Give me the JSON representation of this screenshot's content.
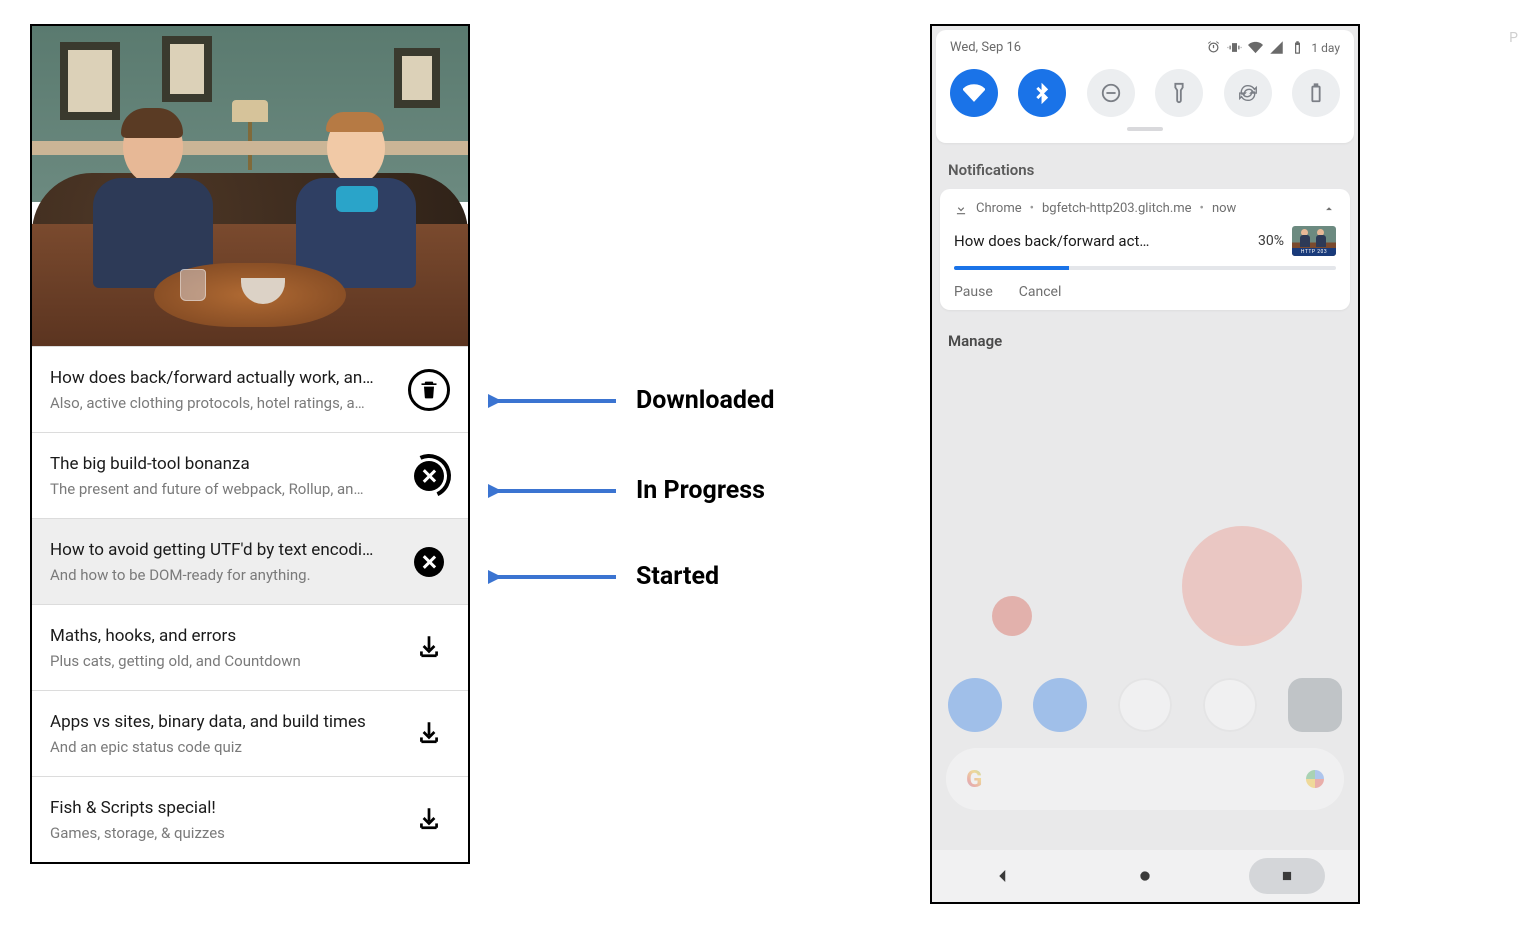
{
  "left": {
    "episodes": [
      {
        "title": "How does back/forward actually work, an…",
        "subtitle": "Also, active clothing protocols, hotel ratings, a…",
        "state": "downloaded",
        "selected": false
      },
      {
        "title": "The big build-tool bonanza",
        "subtitle": "The present and future of webpack, Rollup, an…",
        "state": "in_progress",
        "selected": false
      },
      {
        "title": "How to avoid getting UTF'd by text encodi…",
        "subtitle": "And how to be DOM-ready for anything.",
        "state": "started",
        "selected": true
      },
      {
        "title": "Maths, hooks, and errors",
        "subtitle": "Plus cats, getting old, and Countdown",
        "state": "not_downloaded",
        "selected": false
      },
      {
        "title": "Apps vs sites, binary data, and build times",
        "subtitle": "And an epic status code quiz",
        "state": "not_downloaded",
        "selected": false
      },
      {
        "title": "Fish & Scripts special!",
        "subtitle": "Games, storage, & quizzes",
        "state": "not_downloaded",
        "selected": false
      }
    ]
  },
  "annotations": {
    "downloaded": "Downloaded",
    "in_progress": "In Progress",
    "started": "Started"
  },
  "right": {
    "date": "Wed, Sep 16",
    "battery_label": "1 day",
    "toggles": [
      {
        "name": "wifi",
        "on": true
      },
      {
        "name": "bluetooth",
        "on": true
      },
      {
        "name": "dnd",
        "on": false
      },
      {
        "name": "flashlight",
        "on": false
      },
      {
        "name": "autorotate",
        "on": false
      },
      {
        "name": "battery-saver",
        "on": false
      }
    ],
    "section_label": "Notifications",
    "notification": {
      "app": "Chrome",
      "source": "bgfetch-http203.glitch.me",
      "time": "now",
      "title": "How does back/forward act…",
      "percent_text": "30%",
      "percent_value": 30,
      "thumb_caption": "HTTP 203",
      "actions": {
        "pause": "Pause",
        "cancel": "Cancel"
      }
    },
    "manage_label": "Manage",
    "search_placeholder_letter": "G"
  },
  "colors": {
    "accent": "#1a73e8",
    "arrow": "#3b74d1"
  },
  "page_marker": "P"
}
